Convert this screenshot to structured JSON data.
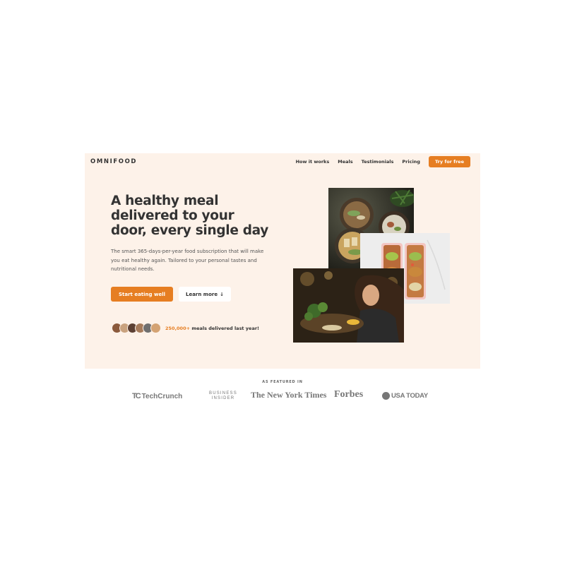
{
  "brand": {
    "logo": "OMNIFOOD",
    "accent": "#e67e22",
    "background": "#fdf2e9"
  },
  "nav": {
    "items": [
      "How it works",
      "Meals",
      "Testimonials",
      "Pricing"
    ],
    "cta": "Try for free"
  },
  "hero": {
    "title": "A healthy meal delivered to your door, every single day",
    "description": "The smart 365-days-per-year food subscription that will make you eat healthy again. Tailored to your personal tastes and nutritional needs.",
    "primary_button": "Start eating well",
    "secondary_button": "Learn more",
    "secondary_icon": "arrow-down-icon",
    "delivered_count": "250,000+",
    "delivered_text": "meals delivered last year!"
  },
  "featured": {
    "label": "AS FEATURED IN",
    "logos": {
      "techcrunch": "TechCrunch",
      "techcrunch_mark": "TC",
      "business_insider_1": "BUSINESS",
      "business_insider_2": "INSIDER",
      "nyt": "The New York Times",
      "forbes": "Forbes",
      "usatoday": "USA TODAY"
    }
  }
}
